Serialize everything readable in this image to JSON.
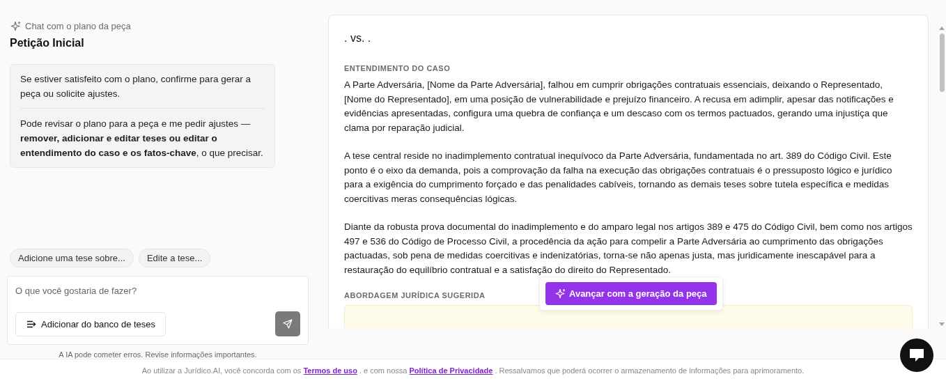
{
  "chat_panel": {
    "eyebrow": "Chat com o plano da peça",
    "title": "Petição Inicial",
    "message": {
      "paragraphs": [
        "Se estiver satisfeito com o plano, confirme para gerar a peça ou solicite ajustes.",
        "Pode revisar o plano para a peça e me pedir ajustes — **remover, adicionar e editar teses ou editar o entendimento do caso e os fatos-chave**, o que precisar."
      ]
    },
    "suggestions": [
      "Adicione uma tese sobre...",
      "Edite a tese..."
    ],
    "input": {
      "placeholder": "O que você gostaria de fazer?",
      "bank_button": "Adicionar do banco de teses",
      "send_disabled": true
    },
    "disclaimer": "A IA pode cometer erros. Revise informações importantes."
  },
  "plan": {
    "heading": ". vs. .",
    "sections": [
      {
        "title": "ENTENDIMENTO DO CASO",
        "paragraphs": [
          "A Parte Adversária, [Nome da Parte Adversária], falhou em cumprir obrigações contratuais essenciais, deixando o Representado, [Nome do Representado], em uma posição de vulnerabilidade e prejuízo financeiro. A recusa em adimplir, apesar das notificações e evidências apresentadas, configura uma quebra de confiança e um descaso com os termos pactuados, gerando uma injustiça que clama por reparação judicial.",
          "A tese central reside no inadimplemento contratual inequívoco da Parte Adversária, fundamentada no art. 389 do Código Civil. Este ponto é o eixo da demanda, pois a comprovação da falha na execução das obrigações contratuais é o pressuposto lógico e jurídico para a exigência do cumprimento forçado e das penalidades cabíveis, tornando as demais teses sobre tutela específica e medidas coercitivas meras consequências lógicas.",
          "Diante da robusta prova documental do inadimplemento e do amparo legal nos artigos 389 e 475 do Código Civil, bem como nos artigos 497 e 536 do Código de Processo Civil, a procedência da ação para compelir a Parte Adversária ao cumprimento das obrigações pactuadas, sob pena de medidas coercitivas e indenizatórias, torna-se não apenas justa, mas juridicamente inescapável para a restauração do equilíbrio contratual e a satisfação do direito do Representado."
        ]
      },
      {
        "title": "ABORDAGEM JURÍDICA SUGERIDA"
      }
    ],
    "proceed_button": "Avançar com a geração da peça"
  },
  "footer": {
    "parts": [
      {
        "kind": "text",
        "text": "Ao utilizar a Jurídico.AI, você concorda com os"
      },
      {
        "kind": "link",
        "text": "Termos de uso"
      },
      {
        "kind": "text",
        "text": ". e com nossa"
      },
      {
        "kind": "link",
        "text": "Política de Privacidade"
      },
      {
        "kind": "text",
        "text": ". Ressalvamos que poderá ocorrer o armazenamento de informações para aprimoramento."
      }
    ]
  }
}
